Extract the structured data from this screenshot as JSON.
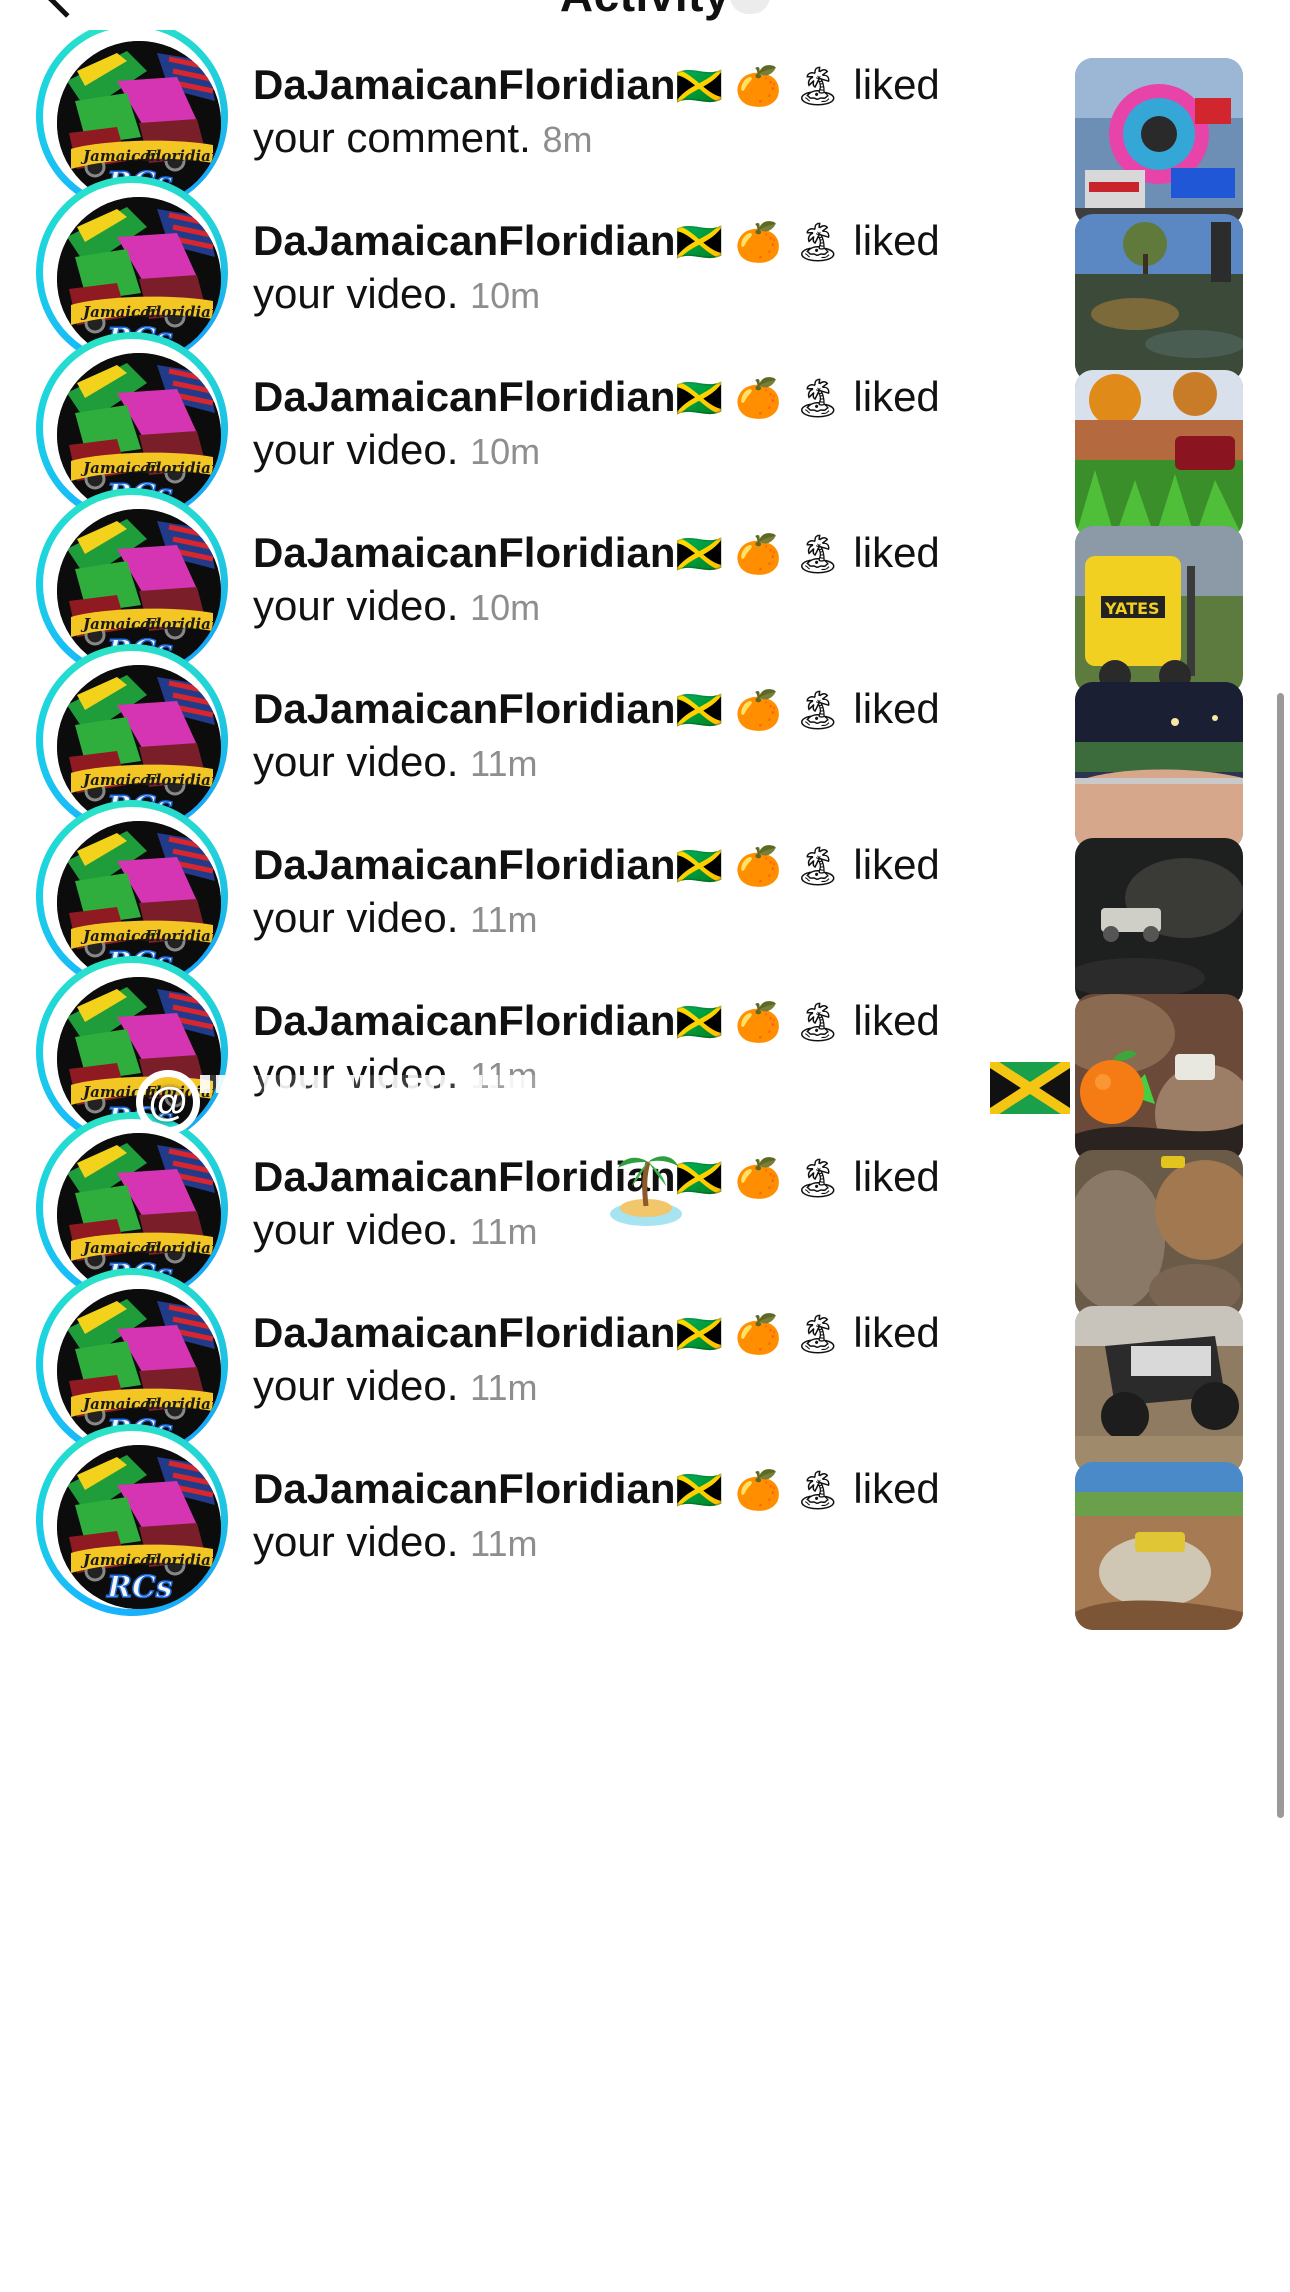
{
  "header": {
    "title": "Activity",
    "back_icon": "chevron-left-icon"
  },
  "colors": {
    "time_gray": "#8e8e8e",
    "ring_blue": "#19b4ff",
    "ring_teal": "#2be3c4",
    "scrollbar": "#9a9a9a"
  },
  "notifications": [
    {
      "username": "DaJamaicanFloridian",
      "flag": "🇯🇲",
      "orange": "🍊",
      "island": "🏝",
      "action": "liked",
      "object": "your comment.",
      "time": "8m"
    },
    {
      "username": "DaJamaicanFloridian",
      "flag": "🇯🇲",
      "orange": "🍊",
      "island": "🏝",
      "action": "liked",
      "object": "your video.",
      "time": "10m"
    },
    {
      "username": "DaJamaicanFloridian",
      "flag": "🇯🇲",
      "orange": "🍊",
      "island": "🏝",
      "action": "liked",
      "object": "your video.",
      "time": "10m"
    },
    {
      "username": "DaJamaicanFloridian",
      "flag": "🇯🇲",
      "orange": "🍊",
      "island": "🏝",
      "action": "liked",
      "object": "your video.",
      "time": "10m"
    },
    {
      "username": "DaJamaicanFloridian",
      "flag": "🇯🇲",
      "orange": "🍊",
      "island": "🏝",
      "action": "liked",
      "object": "your video.",
      "time": "11m"
    },
    {
      "username": "DaJamaicanFloridian",
      "flag": "🇯🇲",
      "orange": "🍊",
      "island": "🏝",
      "action": "liked",
      "object": "your video.",
      "time": "11m"
    },
    {
      "username": "DaJamaicanFloridian",
      "flag": "🇯🇲",
      "orange": "🍊",
      "island": "🏝",
      "action": "liked",
      "object": "your video.",
      "time": "11m"
    },
    {
      "username": "DaJamaicanFloridian",
      "flag": "🇯🇲",
      "orange": "🍊",
      "island": "🏝",
      "action": "liked",
      "object": "your video.",
      "time": "11m"
    },
    {
      "username": "DaJamaicanFloridian",
      "flag": "🇯🇲",
      "orange": "🍊",
      "island": "🏝",
      "action": "liked",
      "object": "your video.",
      "time": "11m"
    },
    {
      "username": "DaJamaicanFloridian",
      "flag": "🇯🇲",
      "orange": "🍊",
      "island": "🏝",
      "action": "liked",
      "object": "your video.",
      "time": "11m"
    }
  ],
  "overlay_stickers": {
    "at_symbol": "@",
    "icons": [
      "jamaica-flag-icon",
      "orange-icon",
      "island-icon"
    ]
  }
}
